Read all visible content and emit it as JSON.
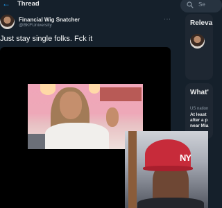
{
  "header": {
    "back_icon": "arrow-left-icon",
    "title": "Thread"
  },
  "tweet": {
    "author_name": "Financial Wig Snatcher",
    "author_handle": "@BKFUniversity",
    "more_icon": "···",
    "text": "Just stay single folks. Fck it"
  },
  "pip_overlay": {
    "cap_logo": "NY"
  },
  "sidebar": {
    "search_placeholder": "Se",
    "relevant_title": "Releva",
    "happening_title": "What'",
    "news_meta": "US nation",
    "news_headline": [
      "At least",
      "after a p",
      "near Mia"
    ]
  },
  "colors": {
    "background": "#15202b",
    "accent": "#1d9bf0",
    "secondary_text": "#8b98a5",
    "card": "#1e2732"
  }
}
